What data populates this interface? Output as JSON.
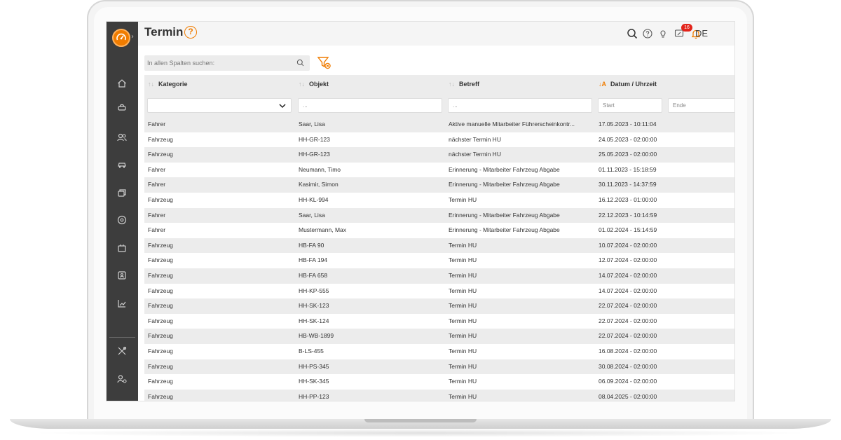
{
  "header": {
    "title": "Termin",
    "help_glyph": "?",
    "notification_count": "16",
    "language": "DE",
    "icons": [
      "search-icon",
      "help-icon",
      "lightbulb-icon",
      "feedback-icon",
      "bell-icon"
    ]
  },
  "sidebar": {
    "icons": [
      "home-icon",
      "car-key-icon",
      "users-icon",
      "car-icon",
      "coins-icon",
      "steering-icon",
      "engine-icon",
      "contacts-icon",
      "chart-icon",
      "tools-icon",
      "user-settings-icon"
    ]
  },
  "toolbar": {
    "search_placeholder": "In allen Spalten suchen:"
  },
  "table": {
    "columns": [
      "Kategorie",
      "Objekt",
      "Betreff",
      "Datum / Uhrzeit"
    ],
    "sort_glyph": "↑↓",
    "sort_active_glyph": "↓A",
    "filters": {
      "kategorie": "",
      "objekt": "...",
      "betreff": "...",
      "start": "Start",
      "ende": "Ende"
    },
    "rows": [
      [
        "Fahrer",
        "Saar, Lisa",
        "Aktive manuelle Mitarbeiter Führerscheinkontr...",
        "17.05.2023 - 10:11:04"
      ],
      [
        "Fahrzeug",
        "HH-GR-123",
        "nächster Termin HU",
        "24.05.2023 - 02:00:00"
      ],
      [
        "Fahrzeug",
        "HH-GR-123",
        "nächster Termin HU",
        "25.05.2023 - 02:00:00"
      ],
      [
        "Fahrer",
        "Neumann, Timo",
        "Erinnerung - Mitarbeiter Fahrzeug Abgabe",
        "01.11.2023 - 15:18:59"
      ],
      [
        "Fahrer",
        "Kasimir, Simon",
        "Erinnerung - Mitarbeiter Fahrzeug Abgabe",
        "30.11.2023 - 14:37:59"
      ],
      [
        "Fahrzeug",
        "HH-KL-994",
        "Termin HU",
        "16.12.2023 - 01:00:00"
      ],
      [
        "Fahrer",
        "Saar, Lisa",
        "Erinnerung - Mitarbeiter Fahrzeug Abgabe",
        "22.12.2023 - 10:14:59"
      ],
      [
        "Fahrer",
        "Mustermann, Max",
        "Erinnerung - Mitarbeiter Fahrzeug Abgabe",
        "01.02.2024 - 15:14:59"
      ],
      [
        "Fahrzeug",
        "HB-FA 90",
        "Termin HU",
        "10.07.2024 - 02:00:00"
      ],
      [
        "Fahrzeug",
        "HB-FA 194",
        "Termin HU",
        "12.07.2024 - 02:00:00"
      ],
      [
        "Fahrzeug",
        "HB-FA 658",
        "Termin HU",
        "14.07.2024 - 02:00:00"
      ],
      [
        "Fahrzeug",
        "HH-KP-555",
        "Termin HU",
        "14.07.2024 - 02:00:00"
      ],
      [
        "Fahrzeug",
        "HH-SK-123",
        "Termin HU",
        "22.07.2024 - 02:00:00"
      ],
      [
        "Fahrzeug",
        "HH-SK-124",
        "Termin HU",
        "22.07.2024 - 02:00:00"
      ],
      [
        "Fahrzeug",
        "HB-WB-1899",
        "Termin HU",
        "22.07.2024 - 02:00:00"
      ],
      [
        "Fahrzeug",
        "B-LS-455",
        "Termin HU",
        "16.08.2024 - 02:00:00"
      ],
      [
        "Fahrzeug",
        "HH-PS-345",
        "Termin HU",
        "30.08.2024 - 02:00:00"
      ],
      [
        "Fahrzeug",
        "HH-SK-345",
        "Termin HU",
        "06.09.2024 - 02:00:00"
      ],
      [
        "Fahrzeug",
        "HH-PP-123",
        "Termin HU",
        "08.04.2025 - 02:00:00"
      ]
    ]
  },
  "colors": {
    "accent": "#f07c00",
    "sidebar": "#3d3d3d",
    "badge": "#e2231a",
    "row_alt": "#ececec"
  }
}
